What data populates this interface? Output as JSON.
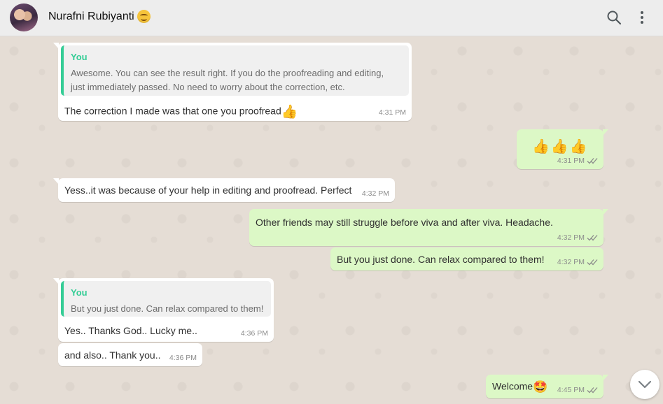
{
  "header": {
    "contact_name": "Nurafni Rubiyanti",
    "status_emoji": "smiling-face",
    "icons": [
      "search-icon",
      "menu-icon"
    ]
  },
  "messages": [
    {
      "direction": "incoming",
      "quote": {
        "author": "You",
        "line1": "Awesome. You can see the result right. If you do the proofreading and editing,",
        "line2": "just immediately passed. No need to worry about the correction, etc."
      },
      "text": "The correction I made was that one you proofread",
      "emoji": "👍",
      "time": "4:31 PM"
    },
    {
      "direction": "outgoing",
      "text": "👍👍👍",
      "time": "4:31 PM",
      "status": "read"
    },
    {
      "direction": "incoming",
      "text": "Yess..it was because of your help in editing and proofread. Perfect",
      "time": "4:32 PM"
    },
    {
      "direction": "outgoing",
      "text": "Other friends may still struggle before viva and after viva. Headache.",
      "time": "4:32 PM",
      "status": "read"
    },
    {
      "direction": "outgoing",
      "text": "But you just done. Can relax compared to them!",
      "time": "4:32 PM",
      "status": "read"
    },
    {
      "direction": "incoming",
      "quote": {
        "author": "You",
        "line1": "But you just done. Can relax compared to them!"
      },
      "text": "Yes.. Thanks God.. Lucky me..",
      "time": "4:36 PM"
    },
    {
      "direction": "incoming",
      "text": "and also.. Thank you..",
      "time": "4:36 PM"
    },
    {
      "direction": "outgoing",
      "text": "Welcome",
      "emoji": "🤩",
      "time": "4:45 PM",
      "status": "read"
    }
  ],
  "colors": {
    "outgoing_bubble": "#dcf8c6",
    "incoming_bubble": "#ffffff",
    "quote_accent": "#35cd96",
    "read_ticks": "#4fc3f7",
    "chat_background": "#e5ddd5"
  }
}
